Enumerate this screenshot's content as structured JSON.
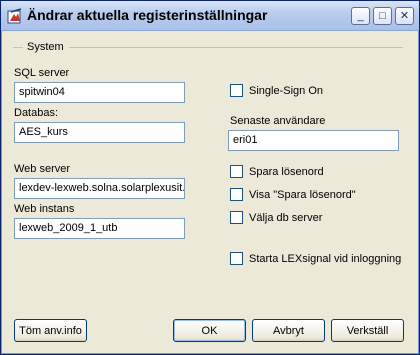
{
  "window": {
    "title": "Ändrar aktuella registerinställningar",
    "controls": {
      "minimize": "_",
      "maximize": "□",
      "close": "✕"
    }
  },
  "group": {
    "label": "System"
  },
  "fields": {
    "sql_server": {
      "label": "SQL server",
      "value": "spitwin04"
    },
    "databas": {
      "label": "Databas:",
      "value": "AES_kurs"
    },
    "web_server": {
      "label": "Web server",
      "value": "lexdev-lexweb.solna.solarplexusit.s"
    },
    "web_instans": {
      "label": "Web instans",
      "value": "lexweb_2009_1_utb"
    },
    "senaste_anvandare": {
      "label": "Senaste användare",
      "value": "eri01"
    }
  },
  "checkboxes": {
    "single_sign_on": {
      "label": "Single-Sign On",
      "checked": false
    },
    "spara_losenord": {
      "label": "Spara lösenord",
      "checked": false
    },
    "visa_spara_losenord": {
      "label": "Visa \"Spara lösenord\"",
      "checked": false
    },
    "valja_db_server": {
      "label": "Välja db server",
      "checked": false
    },
    "starta_lexsignal": {
      "label": "Starta LEXsignal vid inloggning",
      "checked": false
    }
  },
  "buttons": {
    "tom_anv_info": "Töm anv.info",
    "ok": "OK",
    "avbryt": "Avbryt",
    "verkstall": "Verkställ"
  }
}
